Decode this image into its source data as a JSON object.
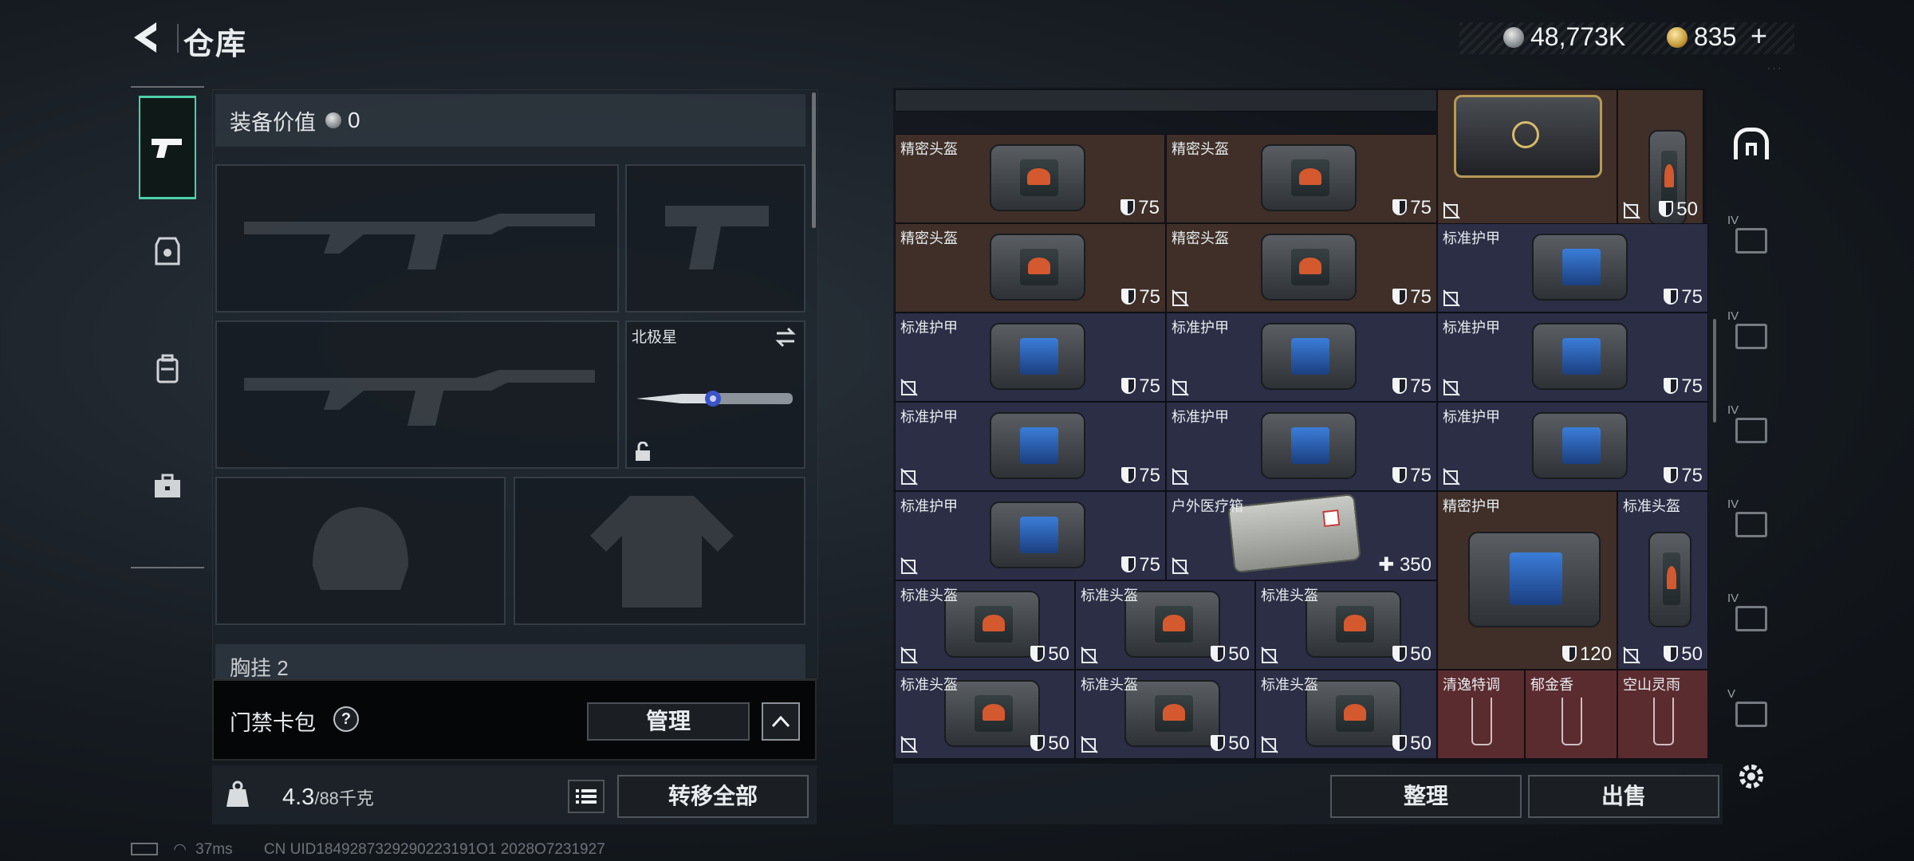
{
  "header": {
    "title": "仓库",
    "silver_amount": "48,773K",
    "gold_amount": "835",
    "add_label": "+"
  },
  "loadout": {
    "equip_value_label": "装备价值",
    "equip_value": "0",
    "melee_name": "北极星",
    "pouch_peek_label": "胸挂 2",
    "keycard_label": "门禁卡包",
    "help_label": "?",
    "manage_label": "管理",
    "weight_value": "4.3",
    "weight_max": "/88千克",
    "transfer_all_label": "转移全部"
  },
  "stash": {
    "items": [
      {
        "name": "精密头盔",
        "value": "75",
        "color": "brown",
        "screen": "orange",
        "no_durability": false
      },
      {
        "name": "精密头盔",
        "value": "75",
        "color": "brown",
        "screen": "orange",
        "no_durability": false
      },
      {
        "name": "",
        "value": "50",
        "color": "brown",
        "screen": "orange",
        "no_durability": true
      },
      {
        "name": "精密头盔",
        "value": "75",
        "color": "brown",
        "screen": "orange",
        "no_durability": false
      },
      {
        "name": "精密头盔",
        "value": "75",
        "color": "brown",
        "screen": "orange",
        "no_durability": true
      },
      {
        "name": "标准护甲",
        "value": "75",
        "color": "navy",
        "screen": "blue",
        "no_durability": true
      },
      {
        "name": "标准护甲",
        "value": "75",
        "color": "navy",
        "screen": "blue",
        "no_durability": true
      },
      {
        "name": "标准护甲",
        "value": "75",
        "color": "navy",
        "screen": "blue",
        "no_durability": true
      },
      {
        "name": "标准护甲",
        "value": "75",
        "color": "navy",
        "screen": "blue",
        "no_durability": true
      },
      {
        "name": "标准护甲",
        "value": "75",
        "color": "navy",
        "screen": "blue",
        "no_durability": true
      },
      {
        "name": "标准护甲",
        "value": "75",
        "color": "navy",
        "screen": "blue",
        "no_durability": true
      },
      {
        "name": "标准护甲",
        "value": "75",
        "color": "navy",
        "screen": "blue",
        "no_durability": true
      },
      {
        "name": "标准护甲",
        "value": "75",
        "color": "navy",
        "screen": "blue",
        "no_durability": true
      },
      {
        "name": "户外医疗箱",
        "value": "350",
        "color": "navy",
        "screen": "medkit",
        "no_durability": true
      },
      {
        "name": "精密护甲",
        "value": "120",
        "color": "brown",
        "screen": "blue",
        "no_durability": false
      },
      {
        "name": "标准头盔",
        "value": "50",
        "color": "navy",
        "screen": "orange",
        "no_durability": true
      },
      {
        "name": "标准头盔",
        "value": "50",
        "color": "navy",
        "screen": "orange",
        "no_durability": true
      },
      {
        "name": "标准头盔",
        "value": "50",
        "color": "navy",
        "screen": "orange",
        "no_durability": true
      },
      {
        "name": "标准头盔",
        "value": "50",
        "color": "navy",
        "screen": "orange",
        "no_durability": true
      },
      {
        "name": "标准头盔",
        "value": "50",
        "color": "navy",
        "screen": "orange",
        "no_durability": true
      },
      {
        "name": "标准头盔",
        "value": "50",
        "color": "navy",
        "screen": "orange",
        "no_durability": true
      },
      {
        "name": "标准头盔",
        "value": "50",
        "color": "navy",
        "screen": "orange",
        "no_durability": true
      },
      {
        "name": "清逸特调",
        "value": "",
        "color": "red",
        "screen": "drink",
        "no_durability": false
      },
      {
        "name": "郁金香",
        "value": "",
        "color": "red",
        "screen": "drink",
        "no_durability": false
      },
      {
        "name": "空山灵雨",
        "value": "",
        "color": "red",
        "screen": "drink",
        "no_durability": false
      }
    ],
    "sort_label": "整理",
    "sell_label": "出售"
  },
  "filters": [
    {
      "tier": "",
      "icon": "all-items-icon"
    },
    {
      "tier": "IV",
      "icon": "helmet-filter-icon"
    },
    {
      "tier": "IV",
      "icon": "armor-filter-icon"
    },
    {
      "tier": "IV",
      "icon": "rig-filter-icon"
    },
    {
      "tier": "IV",
      "icon": "backpack-filter-icon"
    },
    {
      "tier": "IV",
      "icon": "container-filter-icon"
    },
    {
      "tier": "V",
      "icon": "case-filter-icon"
    }
  ],
  "status": {
    "ping": "37ms",
    "uid": "CN UID1849287329290223191O1 2028O7231927"
  },
  "colors": {
    "accent": "#4ecfa8",
    "brown_cell": "#3f2f28",
    "navy_cell": "#2b2e45",
    "red_cell": "#5a2b2f"
  }
}
